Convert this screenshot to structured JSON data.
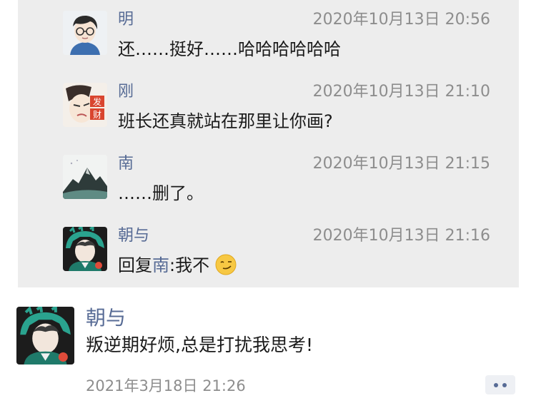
{
  "comments": [
    {
      "name": "明",
      "time": "2020年10月13日 20:56",
      "text": "还……挺好……哈哈哈哈哈哈",
      "avatar_icon": "glasses-boy-avatar"
    },
    {
      "name": "刚",
      "time": "2020年10月13日 21:10",
      "text": "班长还真就站在那里让你画?",
      "avatar_icon": "cartoon-face-avatar"
    },
    {
      "name": "南",
      "time": "2020年10月13日 21:15",
      "text": "……删了。",
      "avatar_icon": "ink-mountain-avatar"
    },
    {
      "name": "朝与",
      "time": "2020年10月13日 21:16",
      "reply_label": "回复",
      "reply_target": "南",
      "reply_sep": ":",
      "text": "我不",
      "emoji": "smirk-emoji",
      "avatar_icon": "dinosaur-hood-avatar"
    }
  ],
  "post": {
    "author": "朝与",
    "text": "叛逆期好烦,总是打扰我思考!",
    "time": "2021年3月18日 21:26",
    "avatar_icon": "dinosaur-hood-avatar",
    "more_icon": "more-dots-icon"
  },
  "colors": {
    "link": "#576b95",
    "time": "#8d8d8d",
    "panel": "#ededed"
  }
}
